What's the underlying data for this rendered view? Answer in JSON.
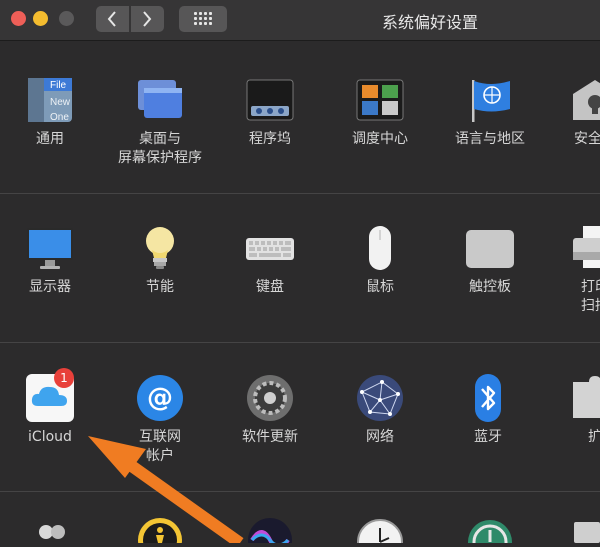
{
  "window": {
    "title": "系统偏好设置"
  },
  "rows": [
    {
      "items": [
        {
          "label": "通用",
          "icon": "general-icon"
        },
        {
          "label": "桌面与\n屏幕保护程序",
          "icon": "desktop-screensaver-icon"
        },
        {
          "label": "程序坞",
          "icon": "dock-icon"
        },
        {
          "label": "调度中心",
          "icon": "mission-control-icon"
        },
        {
          "label": "语言与地区",
          "icon": "language-region-icon"
        },
        {
          "label": "安全性",
          "icon": "security-icon"
        }
      ]
    },
    {
      "items": [
        {
          "label": "显示器",
          "icon": "display-icon"
        },
        {
          "label": "节能",
          "icon": "energy-saver-icon"
        },
        {
          "label": "键盘",
          "icon": "keyboard-icon"
        },
        {
          "label": "鼠标",
          "icon": "mouse-icon"
        },
        {
          "label": "触控板",
          "icon": "trackpad-icon"
        },
        {
          "label": "打印\n扫描",
          "icon": "printer-icon"
        }
      ]
    },
    {
      "items": [
        {
          "label": "iCloud",
          "icon": "icloud-icon",
          "badge": "1"
        },
        {
          "label": "互联网\n帐户",
          "icon": "internet-accounts-icon"
        },
        {
          "label": "软件更新",
          "icon": "software-update-icon"
        },
        {
          "label": "网络",
          "icon": "network-icon"
        },
        {
          "label": "蓝牙",
          "icon": "bluetooth-icon"
        },
        {
          "label": "扩",
          "icon": "extensions-icon"
        }
      ]
    }
  ],
  "general_icon_text": [
    "File",
    "New",
    "One"
  ],
  "colors": {
    "background": "#2c2b2c",
    "annotation_arrow": "#f07c22",
    "badge": "#e8403a"
  }
}
